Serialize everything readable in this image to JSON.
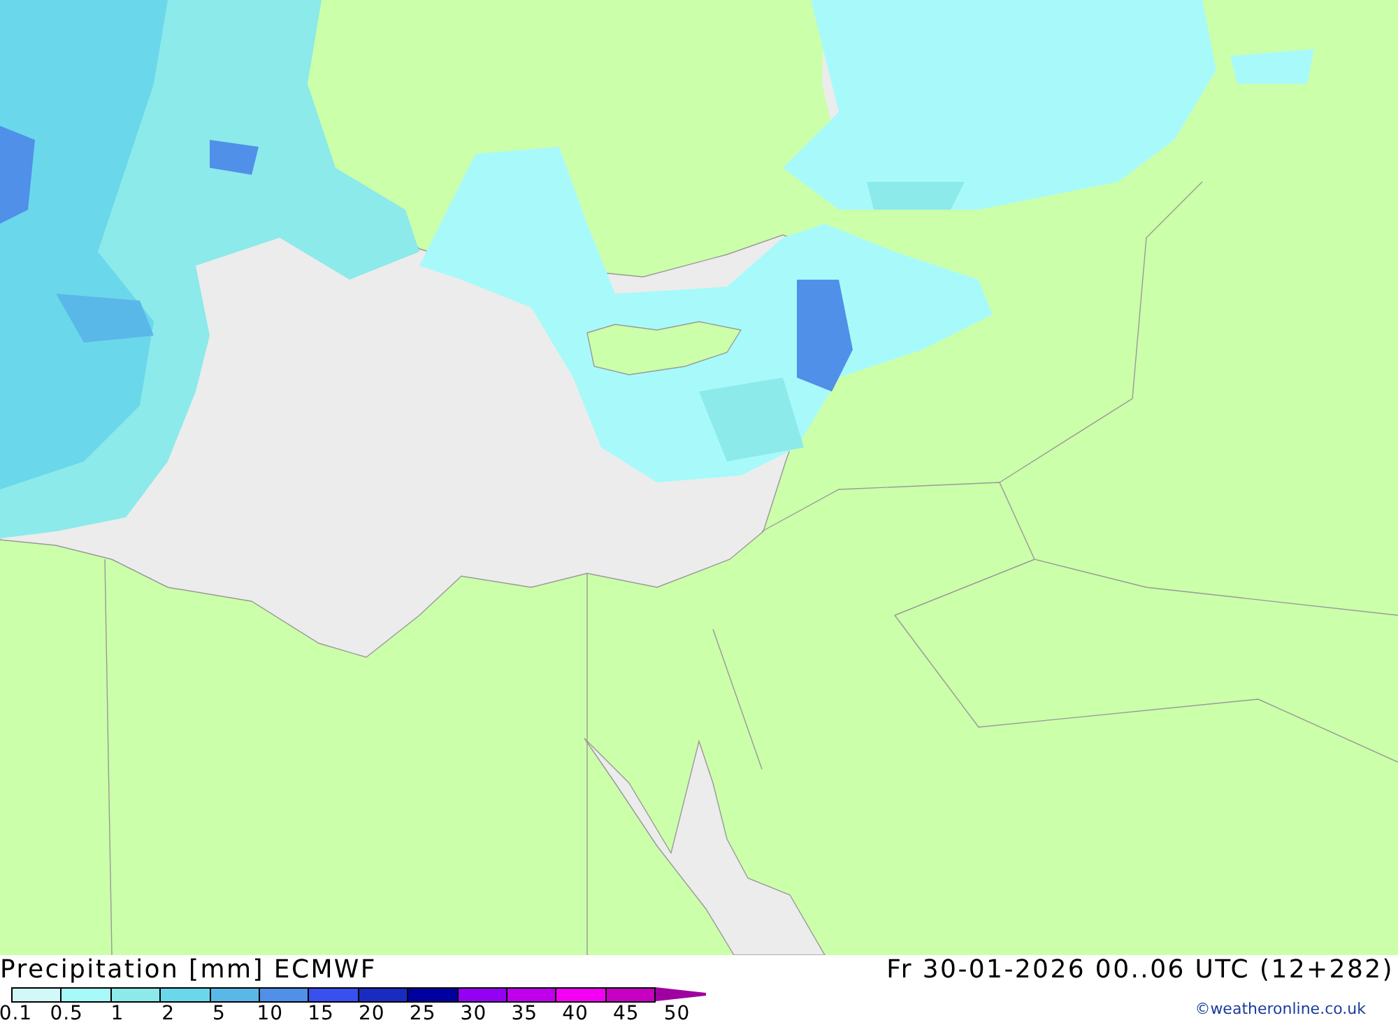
{
  "map": {
    "title": "Precipitation [mm] ECMWF",
    "valid_time": "Fr 30-01-2026 00..06 UTC (12+282)"
  },
  "legend": {
    "swatches": [
      {
        "kind": "band",
        "color": "#d2f8f8"
      },
      {
        "kind": "band",
        "color": "#a8fafa"
      },
      {
        "kind": "band",
        "color": "#8ceaea"
      },
      {
        "kind": "band",
        "color": "#6ad8ea"
      },
      {
        "kind": "band",
        "color": "#5ab8e8"
      },
      {
        "kind": "band",
        "color": "#5090e8"
      },
      {
        "kind": "band",
        "color": "#3850f0"
      },
      {
        "kind": "band",
        "color": "#1a2cc0"
      },
      {
        "kind": "band",
        "color": "#0000a0"
      },
      {
        "kind": "band",
        "color": "#9400f4"
      },
      {
        "kind": "band",
        "color": "#c000ec"
      },
      {
        "kind": "band",
        "color": "#f400f4"
      },
      {
        "kind": "band",
        "color": "#c800c4"
      },
      {
        "kind": "arrow",
        "color": "#a000a0"
      }
    ],
    "labels": [
      "0.1",
      "0.5",
      "1",
      "2",
      "5",
      "10",
      "15",
      "20",
      "25",
      "30",
      "35",
      "40",
      "45",
      "50"
    ]
  },
  "credit": "©weatheronline.co.uk"
}
